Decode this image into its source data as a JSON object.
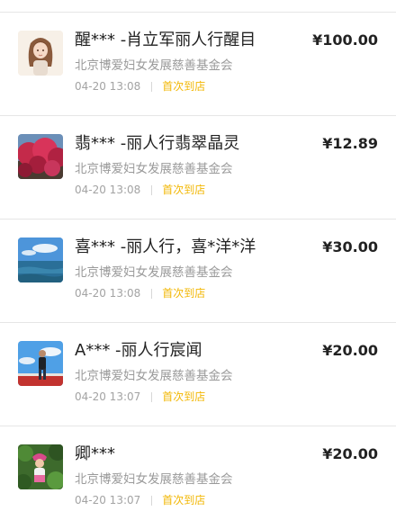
{
  "donations": [
    {
      "donor_name": "醒*** -肖立军丽人行醒目",
      "amount": "¥100.00",
      "organization": "北京博爱妇女发展慈善基金会",
      "time": "04-20 13:08",
      "tag": "首次到店",
      "avatar": "avatar-illustrated-girl"
    },
    {
      "donor_name": "翡*** -丽人行翡翠晶灵",
      "amount": "¥12.89",
      "organization": "北京博爱妇女发展慈善基金会",
      "time": "04-20 13:08",
      "tag": "首次到店",
      "avatar": "avatar-red-foliage"
    },
    {
      "donor_name": "喜*** -丽人行，喜*洋*洋",
      "amount": "¥30.00",
      "organization": "北京博爱妇女发展慈善基金会",
      "time": "04-20 13:08",
      "tag": "首次到店",
      "avatar": "avatar-sea-sky"
    },
    {
      "donor_name": "A*** -丽人行宸闻",
      "amount": "¥20.00",
      "organization": "北京博爱妇女发展慈善基金会",
      "time": "04-20 13:07",
      "tag": "首次到店",
      "avatar": "avatar-man-outdoors"
    },
    {
      "donor_name": "卿***",
      "amount": "¥20.00",
      "organization": "北京博爱妇女发展慈善基金会",
      "time": "04-20 13:07",
      "tag": "首次到店",
      "avatar": "avatar-girl-garden"
    }
  ],
  "colors": {
    "tag": "#f2b705",
    "divider": "#e6e6e6",
    "primary_text": "#222222",
    "secondary_text": "#9a9a9a"
  }
}
